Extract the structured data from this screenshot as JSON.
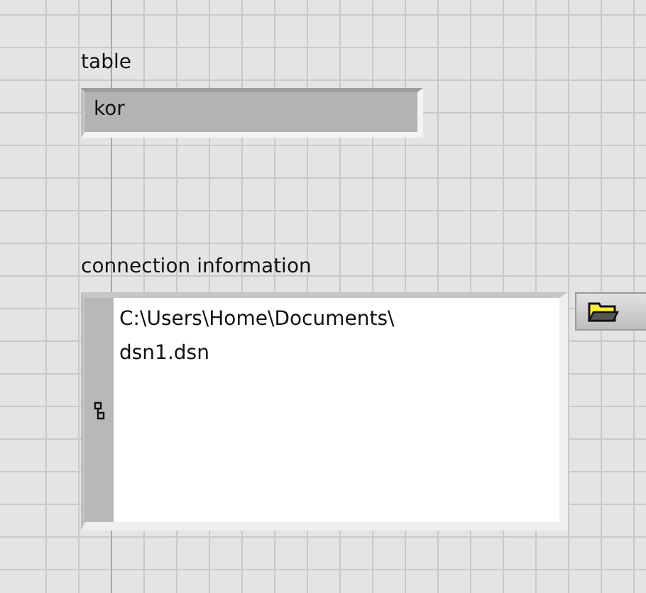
{
  "controls": [
    {
      "kind": "string",
      "label": "table",
      "value": "kor"
    },
    {
      "kind": "path",
      "label": "connection information",
      "value": "C:\\Users\\Home\\Documents\\\ndsn1.dsn"
    }
  ]
}
